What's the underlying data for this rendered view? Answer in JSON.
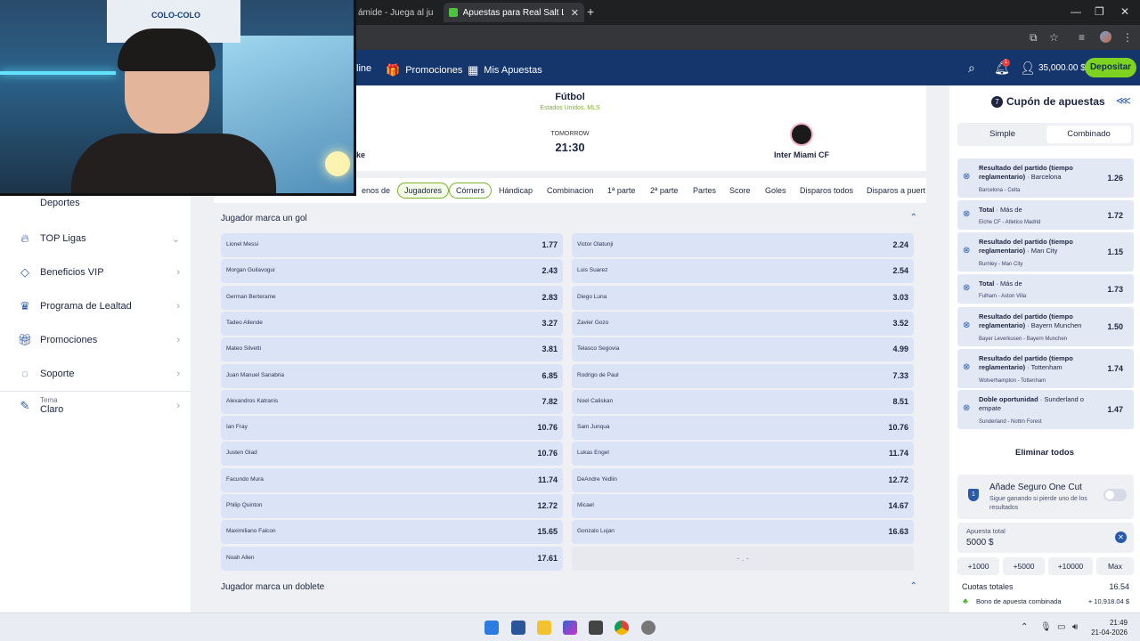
{
  "browser": {
    "tabs": [
      {
        "label": "ámide - Juega al ju",
        "active": false
      },
      {
        "label": "Apuestas para Real Salt Lake vs",
        "active": true
      }
    ],
    "new_tab": "+",
    "controls": {
      "minimize": "—",
      "restore": "❐",
      "close": "✕"
    }
  },
  "header": {
    "nav": [
      {
        "label": "line",
        "icon": ""
      },
      {
        "label": "Promociones",
        "icon": "gift-icon"
      },
      {
        "label": "Mis Apuestas",
        "icon": "tickets-icon"
      }
    ],
    "notif_count": "1",
    "balance": "35,000.00 $",
    "deposit_label": "Depositar",
    "colors": {
      "header_bg": "#15366d",
      "deposit_bg": "#7ed321"
    }
  },
  "sidebar": {
    "items": [
      {
        "label": "Deportes",
        "icon": "ball-icon",
        "sub": ""
      },
      {
        "label": "TOP Ligas",
        "icon": "flame-icon",
        "sub": ""
      },
      {
        "label": "Beneficios VIP",
        "icon": "diamond-icon",
        "sub": ""
      },
      {
        "label": "Programa de Lealtad",
        "icon": "crown-icon",
        "sub": ""
      },
      {
        "label": "Promociones",
        "icon": "gift-icon",
        "sub": ""
      },
      {
        "label": "Soporte",
        "icon": "chat-icon",
        "sub": ""
      },
      {
        "label": "Claro",
        "icon": "brush-icon",
        "sub": "Tema"
      }
    ]
  },
  "match": {
    "sport": "Fútbol",
    "league": "Estados Unidos. MLS",
    "when": "TOMORROW",
    "time": "21:30",
    "home_team_partial": "ke",
    "away_team": "Inter Miami CF"
  },
  "filters": [
    {
      "label": "enos de",
      "state": "normal"
    },
    {
      "label": "Jugadores",
      "state": "selected"
    },
    {
      "label": "Córners",
      "state": "hover"
    },
    {
      "label": "Hándicap",
      "state": "normal"
    },
    {
      "label": "Combinacion",
      "state": "normal"
    },
    {
      "label": "1ª parte",
      "state": "normal"
    },
    {
      "label": "2ª parte",
      "state": "normal"
    },
    {
      "label": "Partes",
      "state": "normal"
    },
    {
      "label": "Score",
      "state": "normal"
    },
    {
      "label": "Goles",
      "state": "normal"
    },
    {
      "label": "Disparos todos",
      "state": "normal"
    },
    {
      "label": "Disparos a puert",
      "state": "normal"
    }
  ],
  "sections": [
    {
      "title": "Jugador marca un gol"
    },
    {
      "title": "Jugador marca un doblete"
    }
  ],
  "odds_left": [
    {
      "name": "Lionel Messi",
      "odd": "1.77"
    },
    {
      "name": "Morgan Guilavogui",
      "odd": "2.43"
    },
    {
      "name": "German Berterame",
      "odd": "2.83"
    },
    {
      "name": "Tadeo Allende",
      "odd": "3.27"
    },
    {
      "name": "Mateo Silvetti",
      "odd": "3.81"
    },
    {
      "name": "Juan Manuel Sanabria",
      "odd": "6.85"
    },
    {
      "name": "Alexandros Katranis",
      "odd": "7.82"
    },
    {
      "name": "Ian Fray",
      "odd": "10.76"
    },
    {
      "name": "Justen Glad",
      "odd": "10.76"
    },
    {
      "name": "Facundo Mura",
      "odd": "11.74"
    },
    {
      "name": "Philip Quinton",
      "odd": "12.72"
    },
    {
      "name": "Maximiliano Falcon",
      "odd": "15.65"
    },
    {
      "name": "Noah Allen",
      "odd": "17.61"
    }
  ],
  "odds_right": [
    {
      "name": "Victor Olatunji",
      "odd": "2.24"
    },
    {
      "name": "Luis Suarez",
      "odd": "2.54"
    },
    {
      "name": "Diego Luna",
      "odd": "3.03"
    },
    {
      "name": "Zavier Gozo",
      "odd": "3.52"
    },
    {
      "name": "Telasco Segovia",
      "odd": "4.99"
    },
    {
      "name": "Rodrigo de Paul",
      "odd": "7.33"
    },
    {
      "name": "Noel Caliskan",
      "odd": "8.51"
    },
    {
      "name": "Sam Junqua",
      "odd": "10.76"
    },
    {
      "name": "Lukas Engel",
      "odd": "11.74"
    },
    {
      "name": "DeAndre Yedlin",
      "odd": "12.72"
    },
    {
      "name": "Micael",
      "odd": "14.67"
    },
    {
      "name": "Gonzalo Lujan",
      "odd": "16.63"
    },
    {
      "name": "",
      "odd": "- . -"
    }
  ],
  "betslip": {
    "count": "7",
    "title": "Cupón de apuestas",
    "tabs": [
      "Simple",
      "Combinado"
    ],
    "active_tab": "Combinado",
    "bets": [
      {
        "market": "Resultado del partido (tiempo reglamentario)",
        "selection": "Barcelona",
        "event": "Barcelona - Celta",
        "odd": "1.26"
      },
      {
        "market": "Total",
        "selection": "Más de",
        "event": "Elche CF - Atletico Madrid",
        "odd": "1.72"
      },
      {
        "market": "Resultado del partido (tiempo reglamentario)",
        "selection": "Man City",
        "event": "Burnley - Man City",
        "odd": "1.15"
      },
      {
        "market": "Total",
        "selection": "Más de",
        "event": "Fulham - Aston Villa",
        "odd": "1.73"
      },
      {
        "market": "Resultado del partido (tiempo reglamentario)",
        "selection": "Bayern Munchen",
        "event": "Bayer Leverkusen - Bayern Munchen",
        "odd": "1.50"
      },
      {
        "market": "Resultado del partido (tiempo reglamentario)",
        "selection": "Tottenham",
        "event": "Wolverhampton - Tottenham",
        "odd": "1.74"
      },
      {
        "market": "Doble oportunidad",
        "selection": "Sunderland o empate",
        "event": "Sunderland - Nottm Forest",
        "odd": "1.47"
      }
    ],
    "remove_all": "Eliminar todos",
    "insurance_title": "Añade Seguro One Cut",
    "insurance_sub": "Sigue ganando si pierde uno de los resultados",
    "stake_label": "Apuesta total",
    "stake_value": "5000 $",
    "quick_amounts": [
      "+1000",
      "+5000",
      "+10000",
      "Max"
    ],
    "total_odds_label": "Cuotas totales",
    "total_odds": "16.54",
    "bonus_label": "Bono de apuesta combinada",
    "bonus_value": "+ 10,918.04 $"
  },
  "webcam": {
    "flag_text": "COLO-COLO"
  },
  "taskbar": {
    "time": "21:49",
    "date": "21-04-2026"
  }
}
